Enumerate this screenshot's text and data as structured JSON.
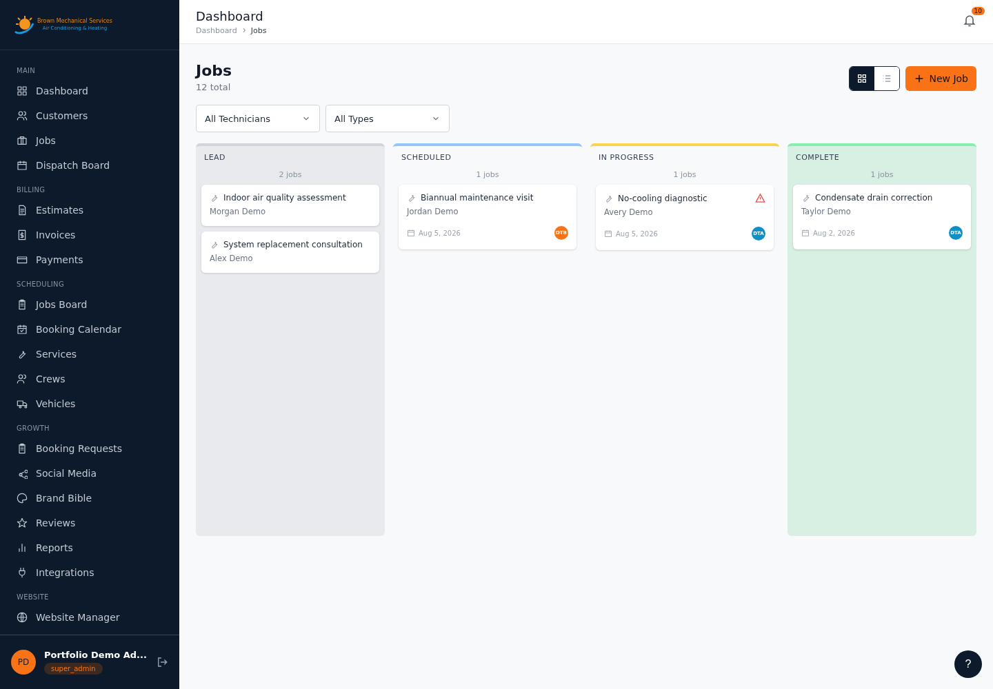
{
  "sidebar": {
    "logo": {
      "name": "Brown Mechanical Services",
      "tagline": "Air Conditioning & Heating"
    },
    "sections": [
      {
        "title": "MAIN",
        "items": [
          {
            "label": "Dashboard"
          },
          {
            "label": "Customers"
          },
          {
            "label": "Jobs"
          },
          {
            "label": "Dispatch Board"
          }
        ]
      },
      {
        "title": "BILLING",
        "items": [
          {
            "label": "Estimates"
          },
          {
            "label": "Invoices"
          },
          {
            "label": "Payments"
          }
        ]
      },
      {
        "title": "SCHEDULING",
        "items": [
          {
            "label": "Jobs Board"
          },
          {
            "label": "Booking Calendar"
          },
          {
            "label": "Services"
          },
          {
            "label": "Crews"
          },
          {
            "label": "Vehicles"
          }
        ]
      },
      {
        "title": "GROWTH",
        "items": [
          {
            "label": "Booking Requests"
          },
          {
            "label": "Social Media"
          },
          {
            "label": "Brand Bible"
          },
          {
            "label": "Reviews"
          },
          {
            "label": "Reports"
          },
          {
            "label": "Integrations"
          }
        ]
      },
      {
        "title": "WEBSITE",
        "items": [
          {
            "label": "Website Manager"
          }
        ]
      }
    ],
    "user": {
      "initials": "PD",
      "name": "Portfolio Demo Ad...",
      "role": "super_admin"
    }
  },
  "header": {
    "title": "Dashboard",
    "breadcrumb": [
      "Dashboard",
      "Jobs"
    ],
    "notifications": "10"
  },
  "page": {
    "title": "Jobs",
    "subtitle": "12 total",
    "view_toggle": [
      {
        "kind": "grid",
        "selected": true
      },
      {
        "kind": "list",
        "selected": false
      }
    ],
    "new_button": "New Job",
    "filters": [
      "All Technicians",
      "All Types"
    ]
  },
  "columns": [
    {
      "title": "LEAD",
      "count": "2 jobs",
      "color": "#d1d5db",
      "shaded": true,
      "cards": [
        {
          "title": "Indoor air quality assessment",
          "customer": "Morgan Demo",
          "alert": false
        },
        {
          "title": "System replacement consultation",
          "customer": "Alex Demo",
          "alert": false
        }
      ]
    },
    {
      "title": "SCHEDULED",
      "count": "1 jobs",
      "color": "#93c5fd",
      "shaded": false,
      "cards": [
        {
          "title": "Biannual maintenance visit",
          "customer": "Jordan Demo",
          "date": "Aug 5, 2026",
          "assignee": "DTB",
          "color": "#f97316",
          "alert": false
        }
      ]
    },
    {
      "title": "IN PROGRESS",
      "count": "1 jobs",
      "color": "#fcd34d",
      "shaded": false,
      "cards": [
        {
          "title": "No-cooling diagnostic",
          "customer": "Avery Demo",
          "date": "Aug 5, 2026",
          "assignee": "DTA",
          "color": "#0e8fc5",
          "alert": true
        }
      ]
    },
    {
      "title": "COMPLETE",
      "count": "1 jobs",
      "color": "#86efac",
      "shaded": true,
      "cards": [
        {
          "title": "Condensate drain correction",
          "customer": "Taylor Demo",
          "date": "Aug 2, 2026",
          "assignee": "DTA",
          "color": "#0e8fc5",
          "alert": false
        }
      ]
    }
  ],
  "help_button": "?"
}
